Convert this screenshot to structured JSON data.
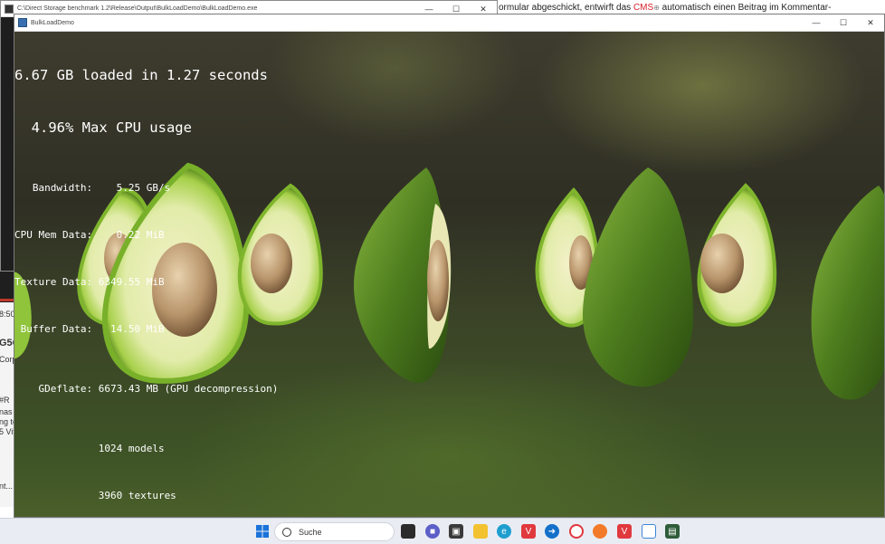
{
  "background_page": {
    "text_before": "ormular abgeschickt, entwirft das ",
    "link": "CMS",
    "text_after": " automatisch einen Beitrag im Kommentar-",
    "left_fragments": [
      "8:50",
      "G5C",
      "Corp",
      "#",
      "#R",
      "nas n",
      "ng to",
      "5 Vits",
      "nt..."
    ]
  },
  "behind_window": {
    "title": "C:\\Direct Storage benchmark 1.2\\Release\\Output\\BulkLoadDemo\\BulkLoadDemo.exe"
  },
  "app_window": {
    "title": "BulkLoadDemo",
    "controls": {
      "minimize": "—",
      "maximize": "☐",
      "close": "✕"
    }
  },
  "overlay": {
    "loaded": "6.67 GB loaded in 1.27 seconds",
    "cpu_usage": "  4.96% Max CPU usage",
    "bandwidth": "   Bandwidth:    5.25 GB/s",
    "cpu_mem": "CPU Mem Data:    0.22 MiB",
    "texture": "Texture Data: 6349.55 MiB",
    "buffer": " Buffer Data:   14.50 MiB",
    "gdeflate": "    GDeflate: 6673.43 MB (GPU decompression)",
    "models": "              1024 models",
    "textures": "              3960 textures"
  },
  "taskbar": {
    "search_label": "Suche",
    "icons": [
      "windows-start",
      "search",
      "task-view",
      "teams",
      "store",
      "file-explorer",
      "edge",
      "vivaldi-1",
      "remote",
      "opera",
      "firefox",
      "vivaldi-2",
      "snipping-tool",
      "terminal"
    ]
  }
}
